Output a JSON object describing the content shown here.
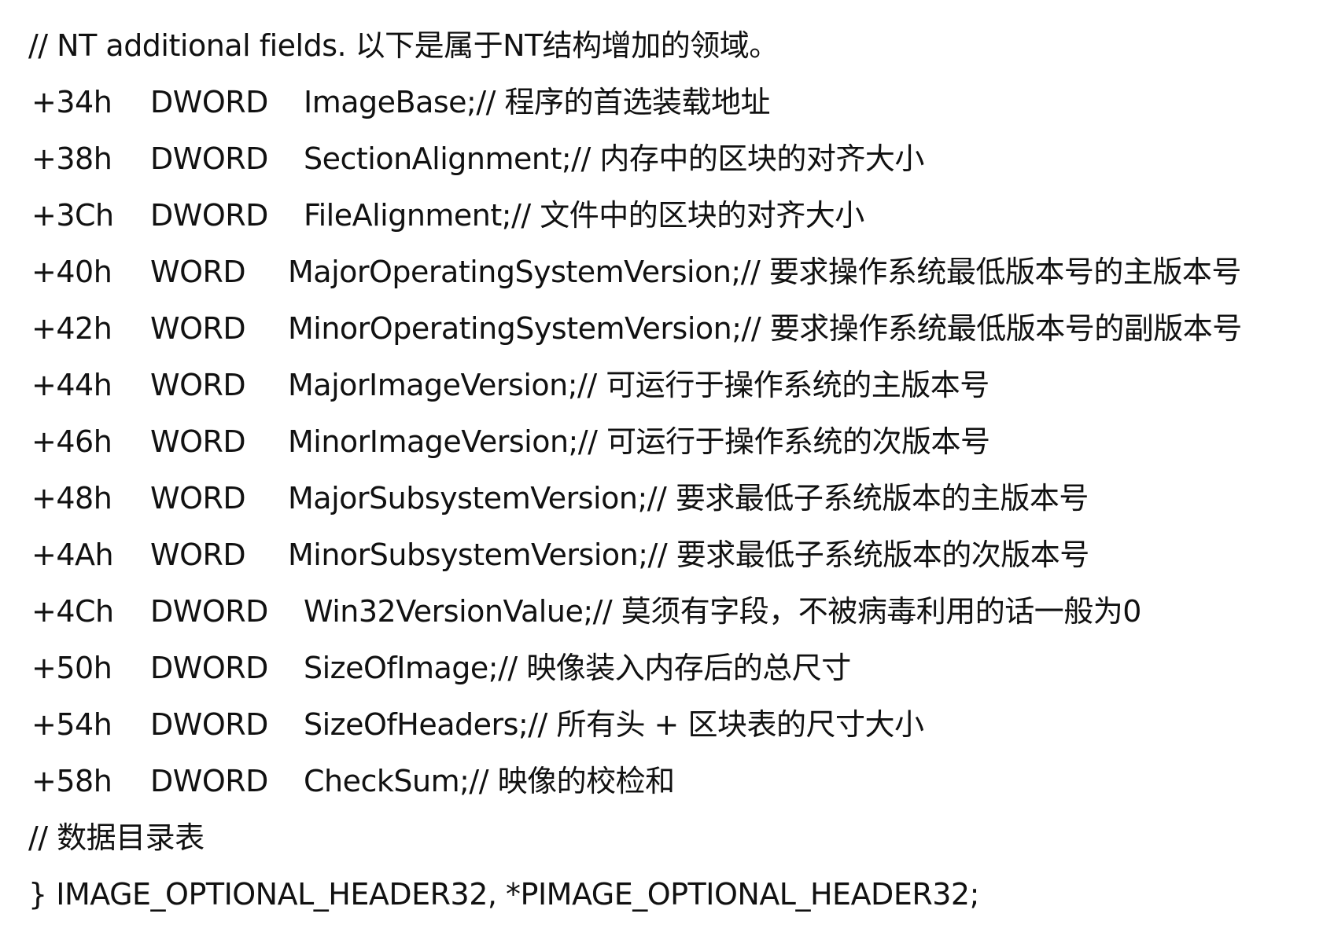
{
  "header_comment": "// NT additional fields.    以下是属于NT结构增加的领域。",
  "fields": [
    {
      "offset": "+34h",
      "type": "DWORD",
      "field": "ImageBase;// 程序的首选装载地址"
    },
    {
      "offset": "+38h",
      "type": "DWORD",
      "field": "SectionAlignment;// 内存中的区块的对齐大小"
    },
    {
      "offset": "+3Ch",
      "type": "DWORD",
      "field": "FileAlignment;// 文件中的区块的对齐大小"
    },
    {
      "offset": "+40h",
      "type": "WORD",
      "field": "MajorOperatingSystemVersion;// 要求操作系统最低版本号的主版本号"
    },
    {
      "offset": "+42h",
      "type": "WORD",
      "field": "MinorOperatingSystemVersion;// 要求操作系统最低版本号的副版本号"
    },
    {
      "offset": "+44h",
      "type": "WORD",
      "field": "MajorImageVersion;// 可运行于操作系统的主版本号"
    },
    {
      "offset": "+46h",
      "type": "WORD",
      "field": "MinorImageVersion;// 可运行于操作系统的次版本号"
    },
    {
      "offset": "+48h",
      "type": "WORD",
      "field": "MajorSubsystemVersion;// 要求最低子系统版本的主版本号"
    },
    {
      "offset": "+4Ah",
      "type": "WORD",
      "field": "MinorSubsystemVersion;// 要求最低子系统版本的次版本号"
    },
    {
      "offset": "+4Ch",
      "type": "DWORD",
      "field": "Win32VersionValue;// 莫须有字段，不被病毒利用的话一般为0"
    },
    {
      "offset": "+50h",
      "type": "DWORD",
      "field": "SizeOfImage;// 映像装入内存后的总尺寸"
    },
    {
      "offset": "+54h",
      "type": "DWORD",
      "field": "SizeOfHeaders;// 所有头 + 区块表的尺寸大小"
    },
    {
      "offset": "+58h",
      "type": "DWORD",
      "field": "CheckSum;// 映像的校检和"
    }
  ],
  "data_directory_comment": "// 数据目录表",
  "closing_line": "} IMAGE_OPTIONAL_HEADER32, *PIMAGE_OPTIONAL_HEADER32;"
}
